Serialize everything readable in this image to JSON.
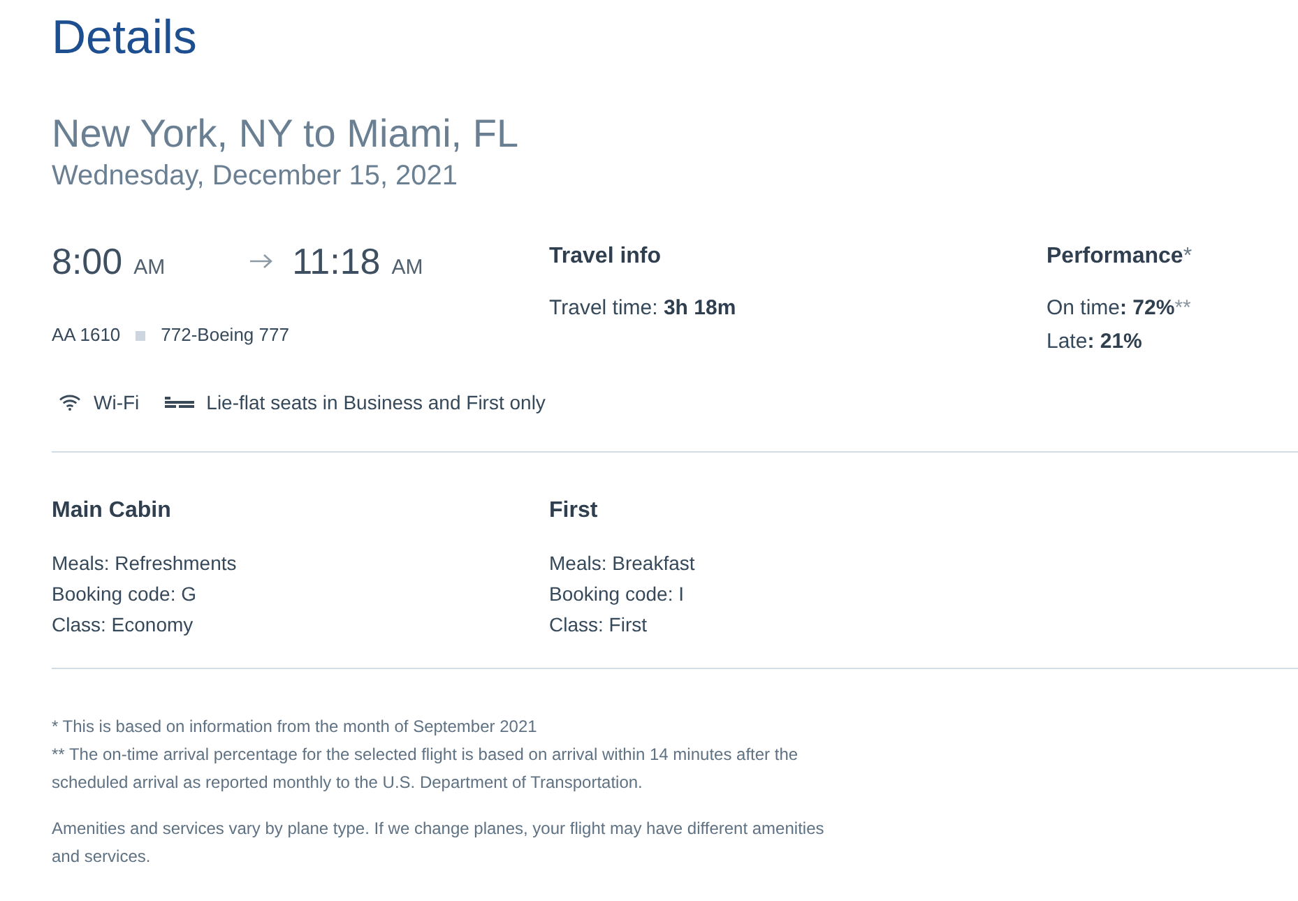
{
  "page": {
    "title": "Details"
  },
  "route": {
    "title": "New York, NY to Miami, FL",
    "date": "Wednesday, December 15, 2021"
  },
  "schedule": {
    "departure": {
      "time": "8:00",
      "period": "AM"
    },
    "arrival": {
      "time": "11:18",
      "period": "AM"
    },
    "flight_number": "AA 1610",
    "aircraft": "772-Boeing 777"
  },
  "travel_info": {
    "heading": "Travel info",
    "items": [
      "Travel time: **3h 18m**"
    ]
  },
  "performance": {
    "heading": "Performance",
    "note": "*",
    "items": [
      {
        "text": "On time**: 72%**",
        "note": "**"
      },
      {
        "text": "Late**: 21%**"
      }
    ]
  },
  "amenities": [
    {
      "kind": "wifi",
      "label": "Wi-Fi"
    },
    {
      "kind": "lie-flat-seat",
      "label": "Lie-flat seats in Business and First only"
    }
  ],
  "cabins": [
    {
      "name": "Main Cabin",
      "details": [
        "Meals: Refreshments",
        "Booking code: G",
        "Class: Economy"
      ]
    },
    {
      "name": "First",
      "details": [
        "Meals: Breakfast",
        "Booking code: I",
        "Class: First"
      ]
    }
  ],
  "footnotes": [
    [
      "* This is based on information from the month of September 2021",
      "** The on-time arrival percentage for the selected flight is based on arrival within 14 minutes after the scheduled arrival as reported monthly to the U.S. Department of Transportation."
    ],
    [
      "Amenities and services vary by plane type. If we change planes, your flight may have different amenities and services."
    ]
  ]
}
